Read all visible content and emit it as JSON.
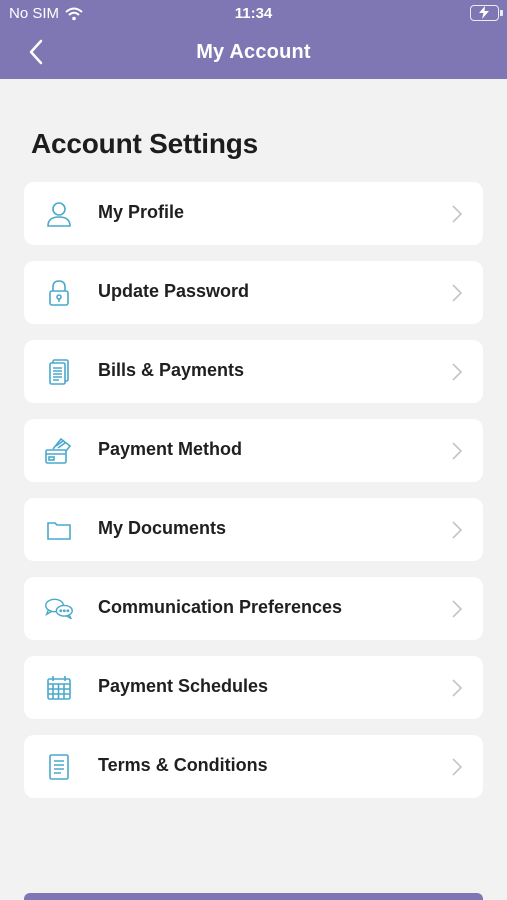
{
  "status_bar": {
    "carrier": "No SIM",
    "time": "11:34"
  },
  "nav": {
    "title": "My Account",
    "back_icon": "chevron-left-icon"
  },
  "section": {
    "title": "Account Settings"
  },
  "menu_items": [
    {
      "label": "My Profile",
      "icon": "user-icon"
    },
    {
      "label": "Update Password",
      "icon": "lock-icon"
    },
    {
      "label": "Bills & Payments",
      "icon": "bills-icon"
    },
    {
      "label": "Payment Method",
      "icon": "card-icon"
    },
    {
      "label": "My Documents",
      "icon": "folder-icon"
    },
    {
      "label": "Communication Preferences",
      "icon": "chat-icon"
    },
    {
      "label": "Payment Schedules",
      "icon": "calendar-icon"
    },
    {
      "label": "Terms & Conditions",
      "icon": "document-icon"
    }
  ],
  "colors": {
    "brand": "#7f76b4",
    "icon": "#4aa8cc",
    "background": "#f2f2f2"
  }
}
